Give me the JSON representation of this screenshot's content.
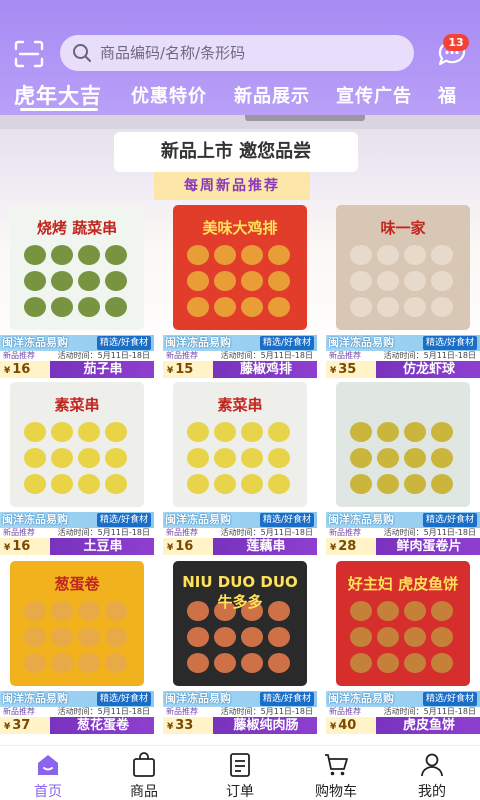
{
  "header": {
    "search_placeholder": "商品编码/名称/条形码",
    "message_count": "13",
    "accent": "#a78bf4"
  },
  "tabs": [
    {
      "label": "虎年大吉"
    },
    {
      "label": "优惠特价"
    },
    {
      "label": "新品展示"
    },
    {
      "label": "宣传广告"
    },
    {
      "label": "福"
    }
  ],
  "banner": {
    "title": "新品上市 邀您品尝",
    "subtitle": "每周新品推荐"
  },
  "card_common": {
    "store": "闽洋冻品易购",
    "tag": "精选/好食材",
    "recommend": "新品推荐",
    "time": "活动时间：5月11日-18日",
    "currency": "¥"
  },
  "products": [
    {
      "price": "16",
      "name": "茄子串",
      "pack_text": "烧烤 蔬菜串",
      "bag_color": "#f1f5f0",
      "food_color": "#6c8a2e"
    },
    {
      "price": "15",
      "name": "藤椒鸡排",
      "pack_text": "美味大鸡排",
      "bag_color": "#e23d2b",
      "food_color": "#e9a738"
    },
    {
      "price": "35",
      "name": "仿龙虾球",
      "pack_text": "味一家",
      "bag_color": "#d9c7b6",
      "food_color": "#e8dccd"
    },
    {
      "price": "16",
      "name": "土豆串",
      "pack_text": "素菜串",
      "bag_color": "#eeeeea",
      "food_color": "#e8cf34"
    },
    {
      "price": "16",
      "name": "莲藕串",
      "pack_text": "素菜串",
      "bag_color": "#eeeeea",
      "food_color": "#e6d03a"
    },
    {
      "price": "28",
      "name": "鲜肉蛋卷片",
      "pack_text": "",
      "bag_color": "#e0e6e2",
      "food_color": "#c8b02a"
    },
    {
      "price": "37",
      "name": "葱花蛋卷",
      "pack_text": "葱蛋卷",
      "bag_color": "#f2b21e",
      "food_color": "#e5a94a"
    },
    {
      "price": "33",
      "name": "藤椒纯肉肠",
      "pack_text": "NIU DUO DUO 牛多多",
      "bag_color": "#2a2a2a",
      "food_color": "#e0794a"
    },
    {
      "price": "40",
      "name": "虎皮鱼饼",
      "pack_text": "好主妇 虎皮鱼饼",
      "bag_color": "#d62d2d",
      "food_color": "#c38a3b"
    }
  ],
  "nav": [
    {
      "label": "首页",
      "icon": "home-icon",
      "active": true
    },
    {
      "label": "商品",
      "icon": "bag-icon",
      "active": false
    },
    {
      "label": "订单",
      "icon": "order-icon",
      "active": false
    },
    {
      "label": "购物车",
      "icon": "cart-icon",
      "active": false
    },
    {
      "label": "我的",
      "icon": "user-icon",
      "active": false
    }
  ]
}
